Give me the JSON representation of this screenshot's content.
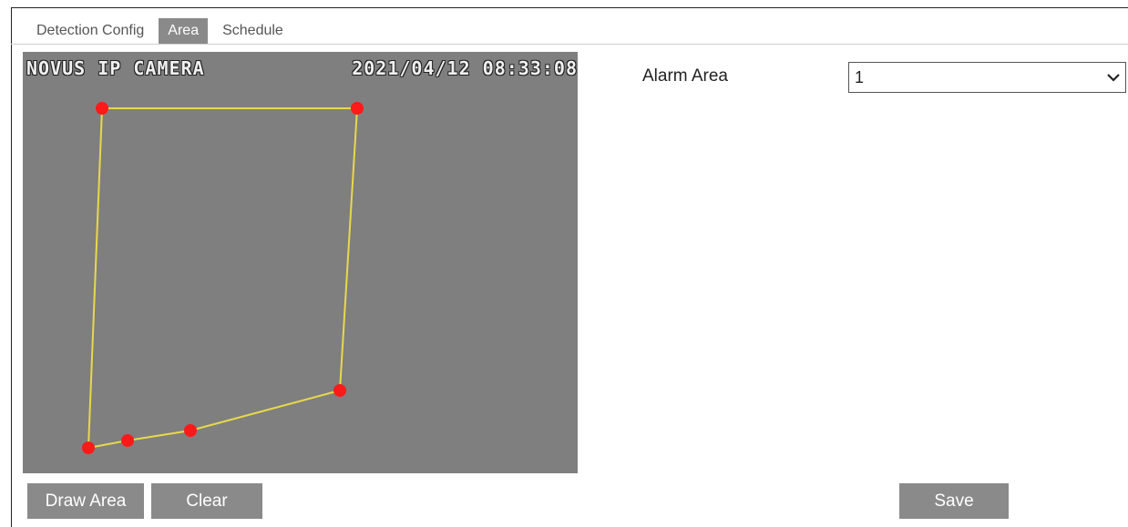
{
  "tabs": [
    {
      "label": "Detection Config",
      "active": false
    },
    {
      "label": "Area",
      "active": true
    },
    {
      "label": "Schedule",
      "active": false
    }
  ],
  "video": {
    "camera_name": "NOVUS IP CAMERA",
    "timestamp": "2021/04/12 08:33:08",
    "background_color": "#7f7f7f",
    "area_line_color": "#e8d84a",
    "vertex_color": "#ff1a1a"
  },
  "alarm_area": {
    "label": "Alarm Area",
    "selected": "1"
  },
  "buttons": {
    "draw_area": "Draw Area",
    "clear": "Clear",
    "save": "Save"
  },
  "accent_color": "#8a8a8a"
}
